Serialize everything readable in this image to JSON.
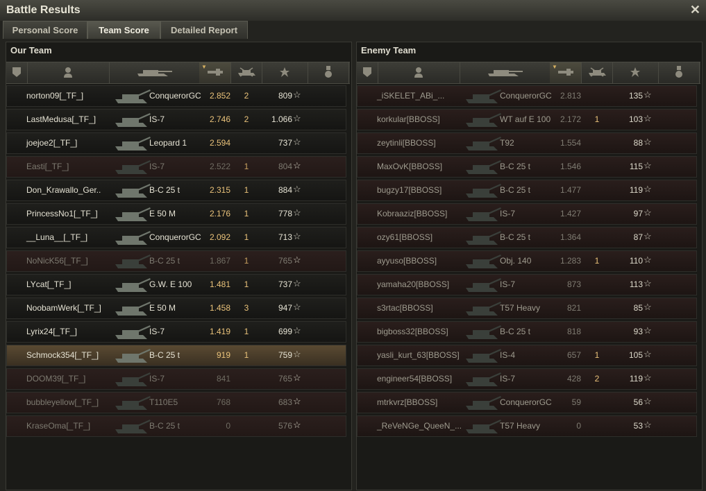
{
  "window": {
    "title": "Battle Results",
    "close_glyph": "✕"
  },
  "tabs": [
    {
      "label": "Personal Score",
      "active": false
    },
    {
      "label": "Team Score",
      "active": true
    },
    {
      "label": "Detailed Report",
      "active": false
    }
  ],
  "our_team": {
    "title": "Our Team",
    "rows": [
      {
        "name": "norton09[_TF_]",
        "tank": "ConquerorGC",
        "damage": "2.852",
        "kills": "2",
        "xp": "809",
        "state": "alive"
      },
      {
        "name": "LastMedusa[_TF_]",
        "tank": "IS-7",
        "damage": "2.746",
        "kills": "2",
        "xp": "1.066",
        "state": "alive"
      },
      {
        "name": "joejoe2[_TF_]",
        "tank": "Leopard 1",
        "damage": "2.594",
        "kills": "",
        "xp": "737",
        "state": "alive"
      },
      {
        "name": "Easti[_TF_]",
        "tank": "IS-7",
        "damage": "2.522",
        "kills": "1",
        "xp": "804",
        "state": "dead"
      },
      {
        "name": "Don_Krawallo_Ger..",
        "tank": "B-C 25 t",
        "damage": "2.315",
        "kills": "1",
        "xp": "884",
        "state": "alive"
      },
      {
        "name": "PrincessNo1[_TF_]",
        "tank": "E 50 M",
        "damage": "2.176",
        "kills": "1",
        "xp": "778",
        "state": "alive"
      },
      {
        "name": "__Luna__[_TF_]",
        "tank": "ConquerorGC",
        "damage": "2.092",
        "kills": "1",
        "xp": "713",
        "state": "alive"
      },
      {
        "name": "NoNicK56[_TF_]",
        "tank": "B-C 25 t",
        "damage": "1.867",
        "kills": "1",
        "xp": "765",
        "state": "dead"
      },
      {
        "name": "LYcat[_TF_]",
        "tank": "G.W. E 100",
        "damage": "1.481",
        "kills": "1",
        "xp": "737",
        "state": "alive"
      },
      {
        "name": "NoobamWerk[_TF_]",
        "tank": "E 50 M",
        "damage": "1.458",
        "kills": "3",
        "xp": "947",
        "state": "alive"
      },
      {
        "name": "Lyrix24[_TF_]",
        "tank": "IS-7",
        "damage": "1.419",
        "kills": "1",
        "xp": "699",
        "state": "alive"
      },
      {
        "name": "Schmock354[_TF_]",
        "tank": "B-C 25 t",
        "damage": "919",
        "kills": "1",
        "xp": "759",
        "state": "me"
      },
      {
        "name": "DOOM39[_TF_]",
        "tank": "IS-7",
        "damage": "841",
        "kills": "",
        "xp": "765",
        "state": "dead"
      },
      {
        "name": "bubbleyellow[_TF_]",
        "tank": "T110E5",
        "damage": "768",
        "kills": "",
        "xp": "683",
        "state": "dead"
      },
      {
        "name": "KraseOma[_TF_]",
        "tank": "B-C 25 t",
        "damage": "0",
        "kills": "",
        "xp": "576",
        "state": "dead"
      }
    ]
  },
  "enemy_team": {
    "title": "Enemy Team",
    "rows": [
      {
        "name": "_iSKELET_ABi_...",
        "tank": "ConquerorGC",
        "damage": "2.813",
        "kills": "",
        "xp": "135"
      },
      {
        "name": "korkular[BBOSS]",
        "tank": "WT auf E 100",
        "damage": "2.172",
        "kills": "1",
        "xp": "103"
      },
      {
        "name": "zeytinli[BBOSS]",
        "tank": "T92",
        "damage": "1.554",
        "kills": "",
        "xp": "88"
      },
      {
        "name": "MaxOvK[BBOSS]",
        "tank": "B-C 25 t",
        "damage": "1.546",
        "kills": "",
        "xp": "115"
      },
      {
        "name": "bugzy17[BBOSS]",
        "tank": "B-C 25 t",
        "damage": "1.477",
        "kills": "",
        "xp": "119"
      },
      {
        "name": "Kobraaziz[BBOSS]",
        "tank": "IS-7",
        "damage": "1.427",
        "kills": "",
        "xp": "97"
      },
      {
        "name": "ozy61[BBOSS]",
        "tank": "B-C 25 t",
        "damage": "1.364",
        "kills": "",
        "xp": "87"
      },
      {
        "name": "ayyuso[BBOSS]",
        "tank": "Obj. 140",
        "damage": "1.283",
        "kills": "1",
        "xp": "110"
      },
      {
        "name": "yamaha20[BBOSS]",
        "tank": "IS-7",
        "damage": "873",
        "kills": "",
        "xp": "113"
      },
      {
        "name": "s3rtac[BBOSS]",
        "tank": "T57 Heavy",
        "damage": "821",
        "kills": "",
        "xp": "85"
      },
      {
        "name": "bigboss32[BBOSS]",
        "tank": "B-C 25 t",
        "damage": "818",
        "kills": "",
        "xp": "93"
      },
      {
        "name": "yasli_kurt_63[BBOSS]",
        "tank": "IS-4",
        "damage": "657",
        "kills": "1",
        "xp": "105"
      },
      {
        "name": "engineer54[BBOSS]",
        "tank": "IS-7",
        "damage": "428",
        "kills": "2",
        "xp": "119"
      },
      {
        "name": "mtrkvrz[BBOSS]",
        "tank": "ConquerorGC",
        "damage": "59",
        "kills": "",
        "xp": "56"
      },
      {
        "name": "_ReVeNGe_QueeN_...",
        "tank": "T57 Heavy",
        "damage": "0",
        "kills": "",
        "xp": "53"
      }
    ]
  },
  "icons": {
    "squad": "squad-icon",
    "player": "player-icon",
    "vehicle": "tank-icon",
    "damage": "gun-icon",
    "kills": "destroyed-tank-icon",
    "xp": "star-icon",
    "medal": "medal-icon"
  },
  "colors": {
    "damage_text": "#e9c27a",
    "player_highlight": "#5a4a32",
    "dead_row": "#2b1f1d"
  }
}
